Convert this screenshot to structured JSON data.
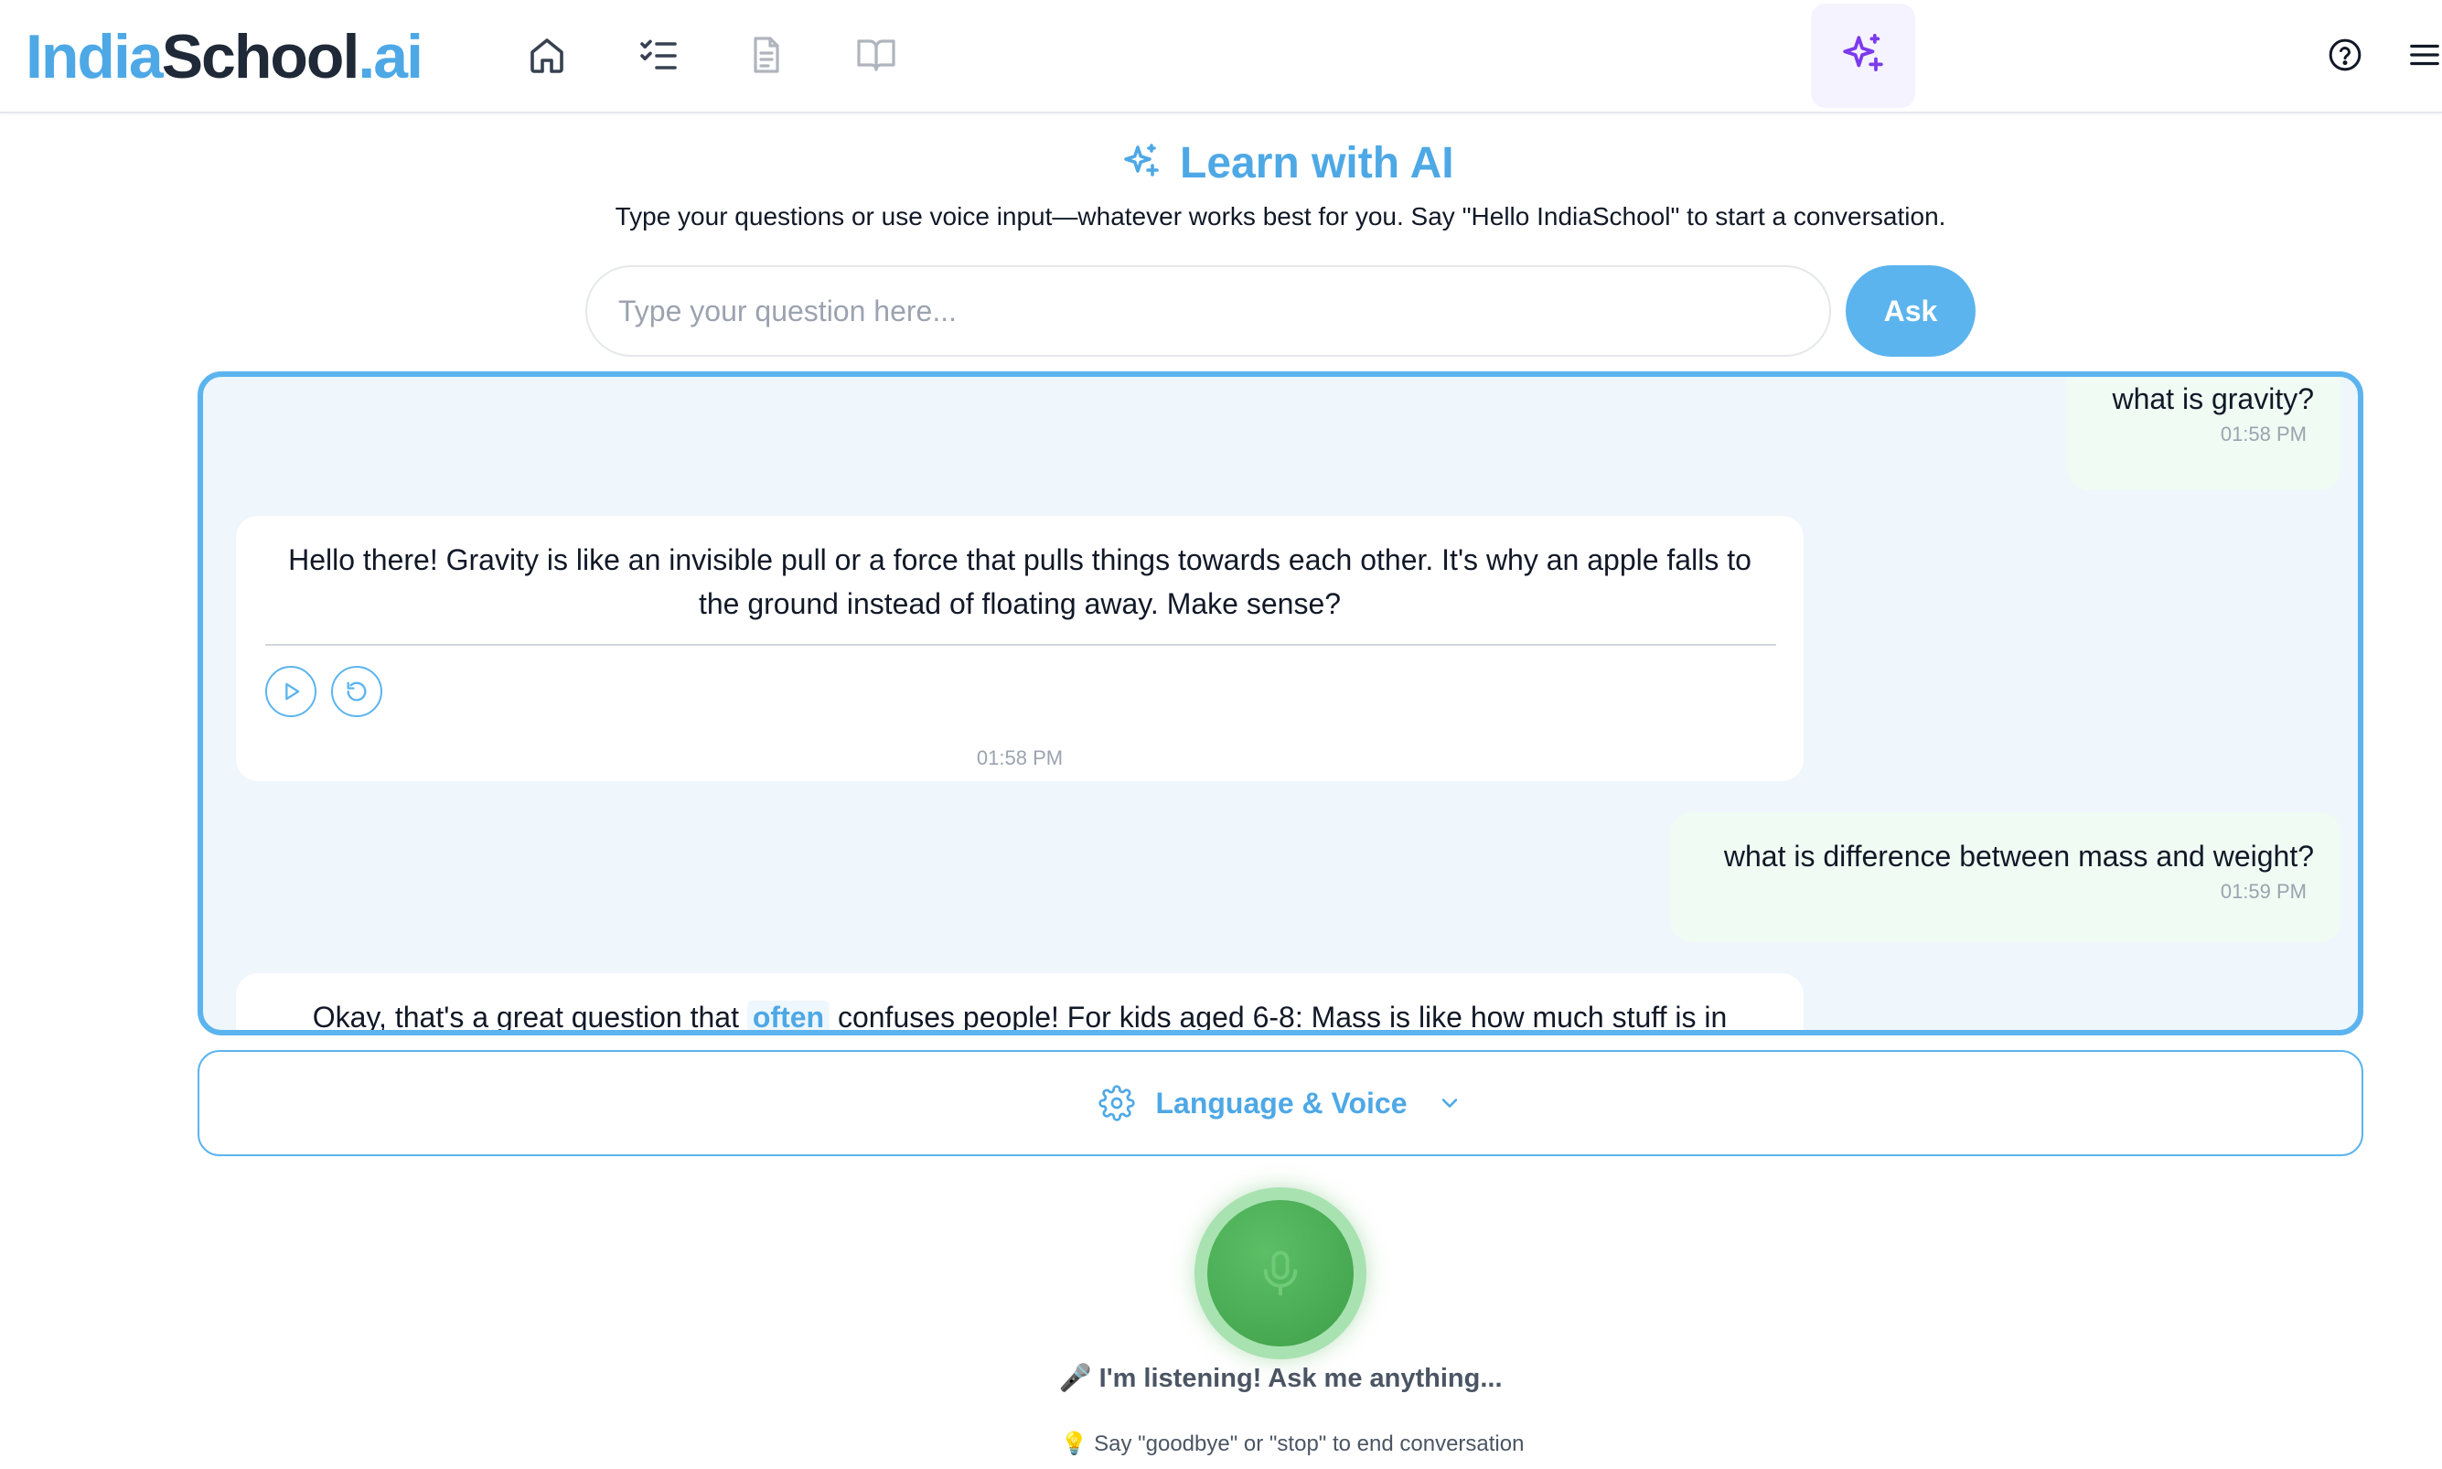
{
  "brand": {
    "part1": "India",
    "part2": "School",
    "part3": ".ai"
  },
  "nav": {
    "icons": [
      "home-icon",
      "checklist-icon",
      "document-icon",
      "book-icon",
      "sparkles-icon"
    ],
    "active": "sparkles-icon"
  },
  "header": {
    "title": "Learn with AI",
    "subtitle": "Type your questions or use voice input—whatever works best for you. Say \"Hello IndiaSchool\" to start a conversation."
  },
  "ask": {
    "placeholder": "Type your question here...",
    "value": "",
    "button_label": "Ask"
  },
  "chat": {
    "messages": [
      {
        "role": "user",
        "text": "what is gravity?",
        "time": "01:58 PM"
      },
      {
        "role": "ai",
        "text": "Hello there! Gravity is like an invisible pull or a force that pulls things towards each other. It's why an apple falls to the ground instead of floating away. Make sense?",
        "time": "01:58 PM"
      },
      {
        "role": "user",
        "text": "what is difference between mass and weight?",
        "time": "01:59 PM"
      },
      {
        "role": "ai",
        "text_before": "Okay, that's a great question that",
        "highlight": "often",
        "text_after": "confuses people! For kids aged 6-8: Mass is like how much stuff is in"
      }
    ]
  },
  "settings": {
    "label": "Language & Voice"
  },
  "voice": {
    "status": "🎤 I'm listening! Ask me anything...",
    "hint": "💡 Say \"goodbye\" or \"stop\" to end conversation"
  },
  "colors": {
    "brand_blue": "#4ea8e6",
    "panel_border": "#5cb4ee",
    "panel_bg": "#eff6fc",
    "user_bubble": "#effbf3",
    "ai_tab_bg": "#f5f3ff",
    "ai_tab_icon": "#7c3aed",
    "mic_green": "#43a94d"
  }
}
